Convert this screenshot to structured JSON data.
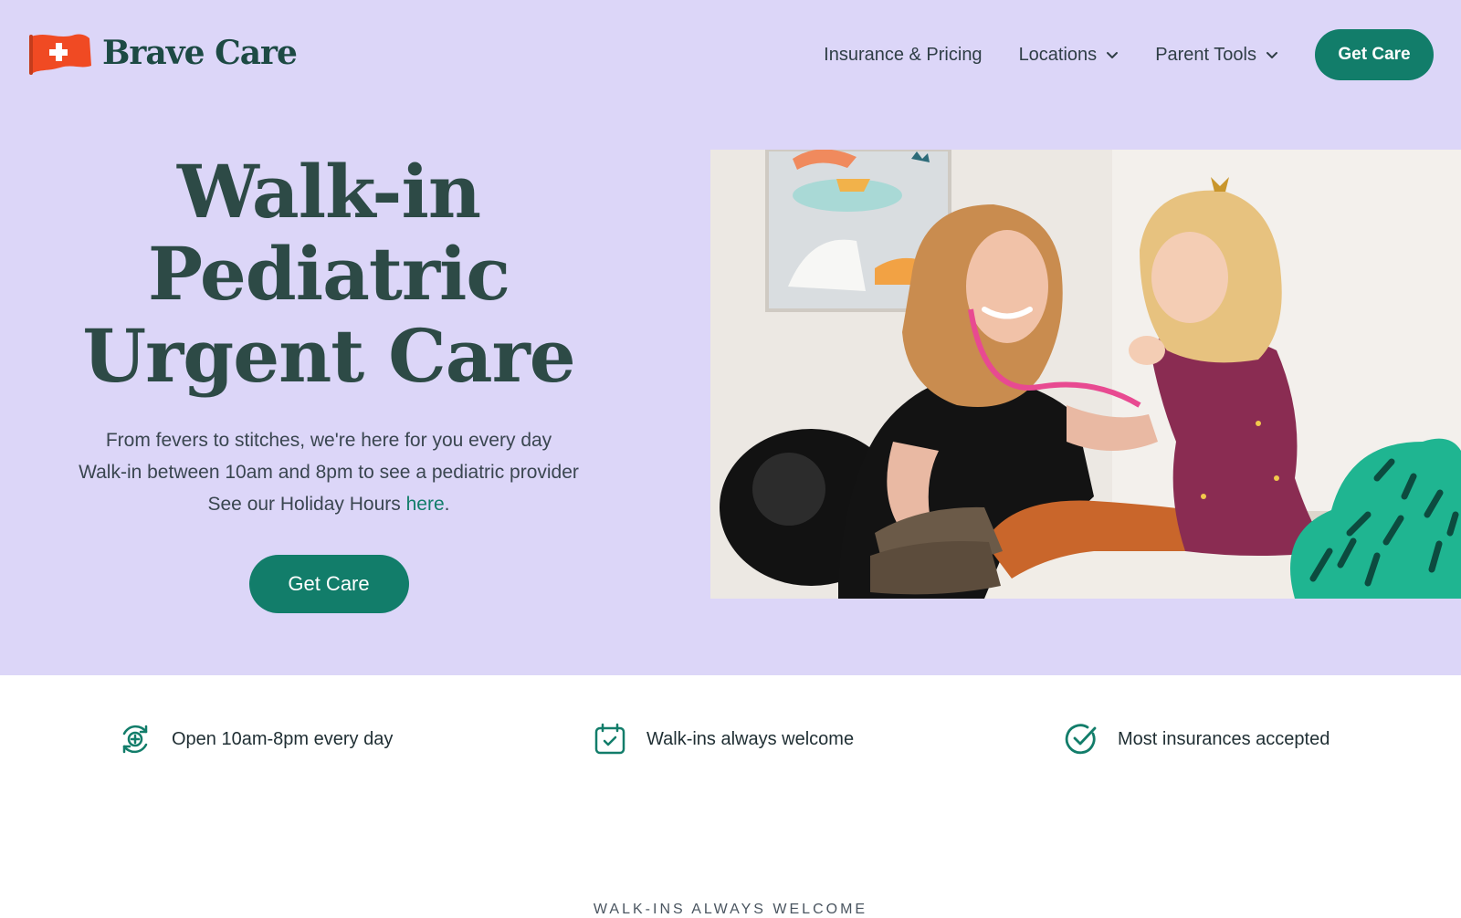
{
  "brand": {
    "name": "Brave Care",
    "accent": "#127d6a",
    "hero_bg": "#dcd6f8",
    "flag_color": "#f04a23"
  },
  "nav": {
    "items": [
      {
        "label": "Insurance & Pricing",
        "has_dropdown": false
      },
      {
        "label": "Locations",
        "has_dropdown": true
      },
      {
        "label": "Parent Tools",
        "has_dropdown": true
      }
    ],
    "cta": "Get Care"
  },
  "hero": {
    "headline": [
      "Walk-in",
      "Pediatric",
      "Urgent Care"
    ],
    "lines": [
      "From fevers to stitches, we're here for you every day",
      "Walk-in between 10am and 8pm to see a pediatric provider"
    ],
    "holiday_prefix": "See our Holiday Hours ",
    "holiday_link": "here",
    "holiday_suffix": ".",
    "cta": "Get Care"
  },
  "features": [
    {
      "icon": "clinic-hours-icon",
      "text": "Open 10am-8pm every day"
    },
    {
      "icon": "calendar-check-icon",
      "text": "Walk-ins always welcome"
    },
    {
      "icon": "check-circle-icon",
      "text": "Most insurances accepted"
    }
  ],
  "next_section": {
    "eyebrow": "WALK-INS ALWAYS WELCOME"
  }
}
